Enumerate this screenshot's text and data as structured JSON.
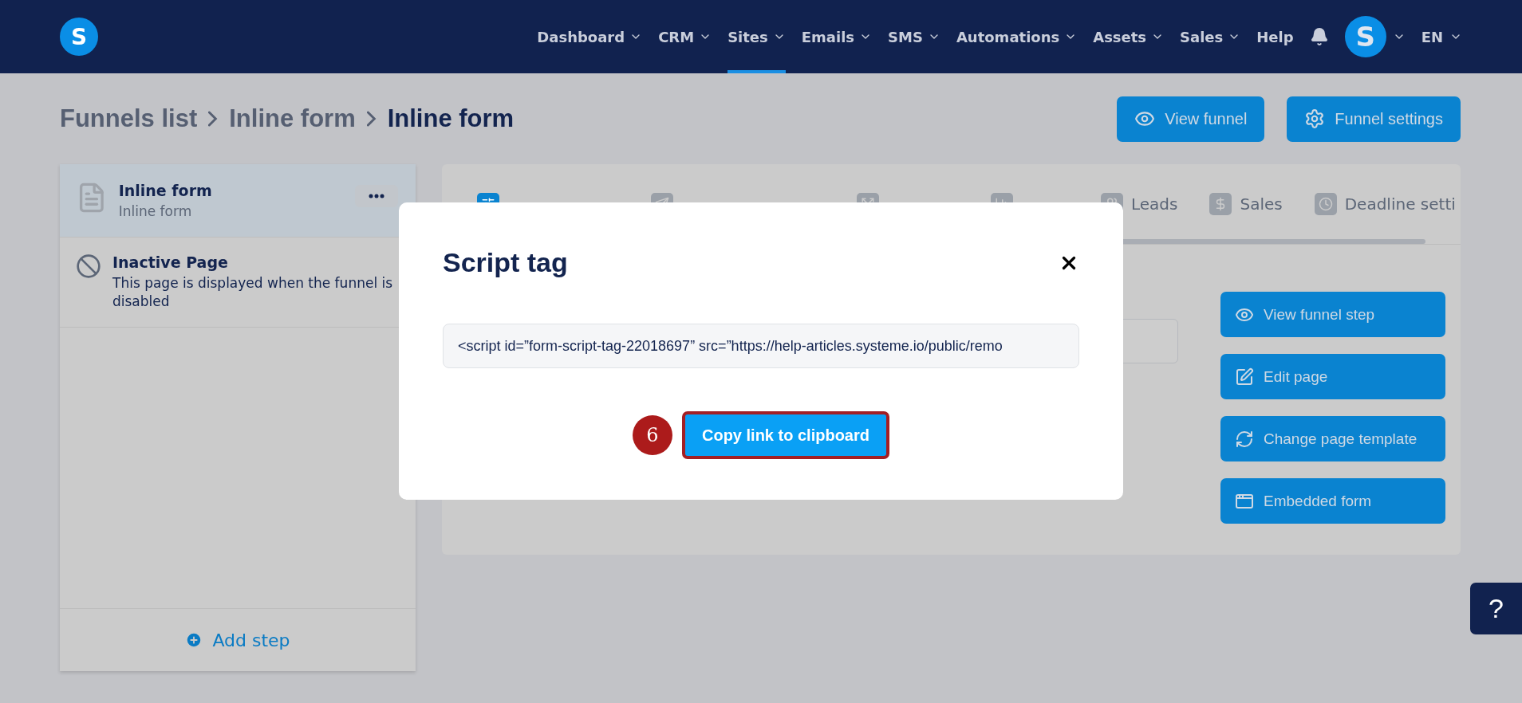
{
  "nav": {
    "logo": "S",
    "items": [
      {
        "label": "Dashboard",
        "dropdown": true,
        "selected": false
      },
      {
        "label": "CRM",
        "dropdown": true,
        "selected": false
      },
      {
        "label": "Sites",
        "dropdown": true,
        "selected": true
      },
      {
        "label": "Emails",
        "dropdown": true,
        "selected": false
      },
      {
        "label": "SMS",
        "dropdown": true,
        "selected": false
      },
      {
        "label": "Automations",
        "dropdown": true,
        "selected": false
      },
      {
        "label": "Assets",
        "dropdown": true,
        "selected": false
      },
      {
        "label": "Sales",
        "dropdown": true,
        "selected": false
      },
      {
        "label": "Help",
        "dropdown": false,
        "selected": false
      }
    ],
    "avatar": "S",
    "language": "EN"
  },
  "breadcrumb": [
    {
      "label": "Funnels list",
      "current": false
    },
    {
      "label": "Inline form",
      "current": false
    },
    {
      "label": "Inline form",
      "current": true
    }
  ],
  "header_buttons": [
    {
      "label": "View funnel",
      "kind": "eye"
    },
    {
      "label": "Funnel settings",
      "kind": "gear"
    }
  ],
  "steps": [
    {
      "kind": "page",
      "title": "Inline form",
      "subtitle": "Inline form",
      "selected": true
    },
    {
      "kind": "inactive",
      "title": "Inactive Page",
      "subtitle": "This page is displayed when the funnel is disabled",
      "selected": false
    }
  ],
  "add_step": "Add step",
  "tabs": [
    {
      "kind": "config",
      "selected": true
    },
    {
      "kind": "send",
      "selected": false
    },
    {
      "kind": "split",
      "selected": false
    },
    {
      "kind": "stats",
      "selected": false
    },
    {
      "label": "Leads",
      "kind": "leads",
      "selected": false
    },
    {
      "label": "Sales",
      "kind": "dollar",
      "selected": false
    },
    {
      "label": "Deadline setti",
      "kind": "clock",
      "selected": false
    }
  ],
  "actions": [
    {
      "label": "View funnel step",
      "kind": "eye"
    },
    {
      "label": "Edit page",
      "kind": "edit"
    },
    {
      "label": "Change page template",
      "kind": "refresh"
    },
    {
      "label": "Embedded form",
      "kind": "code"
    }
  ],
  "modal": {
    "title": "Script tag",
    "value": "<script id=”form-script-tag-22018697” src=”https://help-articles.systeme.io/public/remo",
    "button": "Copy link to clipboard",
    "highlighted": true,
    "step_badge": "6"
  },
  "help_button": "?"
}
